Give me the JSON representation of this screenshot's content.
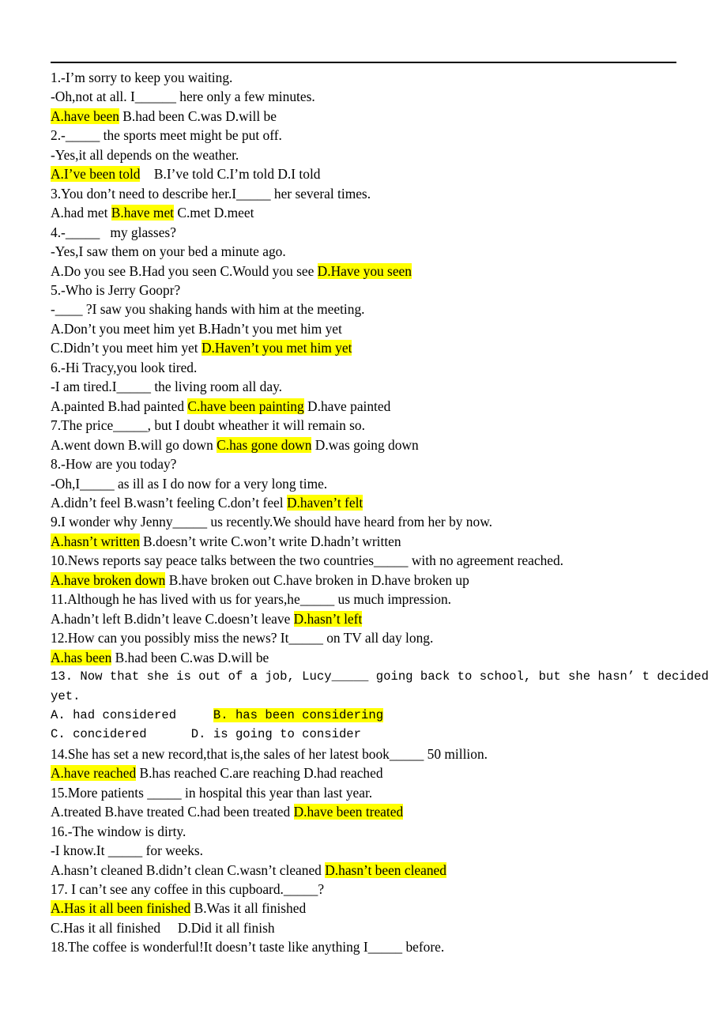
{
  "document": {
    "type": "english-grammar-worksheet",
    "topic": "Present perfect tense multiple-choice exercises",
    "highlight_color": "#ffff00",
    "text_color": "#000000",
    "page_background": "#ffffff",
    "top_rule": true
  },
  "lines": [
    {
      "id": "l1",
      "font": "serif",
      "text": "1.-I’m sorry to keep you waiting."
    },
    {
      "id": "l2",
      "font": "serif",
      "text": "-Oh,not at all. I______ here only a few minutes."
    },
    {
      "id": "l3",
      "font": "serif",
      "pre": "",
      "hl": "A.have been",
      "post": " B.had been C.was D.will be"
    },
    {
      "id": "l4",
      "font": "serif",
      "text": "2.-_____ the sports meet might be put off."
    },
    {
      "id": "l5",
      "font": "serif",
      "text": "-Yes,it all depends on the weather."
    },
    {
      "id": "l6",
      "font": "serif",
      "pre": "",
      "hl": "A.I’ve been told",
      "post": "    B.I’ve told C.I’m told D.I told"
    },
    {
      "id": "l7",
      "font": "serif",
      "text": "3.You don’t need to describe her.I_____ her several times."
    },
    {
      "id": "l8",
      "font": "serif",
      "pre": "A.had met ",
      "hl": "B.have met",
      "post": " C.met D.meet"
    },
    {
      "id": "l9",
      "font": "serif",
      "text": "4.-_____   my glasses?"
    },
    {
      "id": "l10",
      "font": "serif",
      "text": "-Yes,I saw them on your bed a minute ago."
    },
    {
      "id": "l11",
      "font": "serif",
      "pre": "A.Do you see B.Had you seen C.Would you see ",
      "hl": "D.Have you seen",
      "post": ""
    },
    {
      "id": "l12",
      "font": "serif",
      "text": "5.-Who is Jerry Goopr?"
    },
    {
      "id": "l13",
      "font": "serif",
      "text": "-____ ?I saw you shaking hands with him at the meeting."
    },
    {
      "id": "l14",
      "font": "serif",
      "text": "A.Don’t you meet him yet B.Hadn’t you met him yet"
    },
    {
      "id": "l15",
      "font": "serif",
      "pre": "C.Didn’t you meet him yet ",
      "hl": "D.Haven’t you met him yet",
      "post": ""
    },
    {
      "id": "l16",
      "font": "serif",
      "text": "6.-Hi Tracy,you look tired."
    },
    {
      "id": "l17",
      "font": "serif",
      "text": "-I am tired.I_____ the living room all day."
    },
    {
      "id": "l18",
      "font": "serif",
      "pre": "A.painted B.had painted ",
      "hl": "C.have been painting",
      "post": " D.have painted"
    },
    {
      "id": "l19",
      "font": "serif",
      "text": "7.The price_____, but I doubt wheather it will remain so."
    },
    {
      "id": "l20",
      "font": "serif",
      "pre": "A.went down B.will go down ",
      "hl": "C.has gone down",
      "post": " D.was going down"
    },
    {
      "id": "l21",
      "font": "serif",
      "text": "8.-How are you today?"
    },
    {
      "id": "l22",
      "font": "serif",
      "text": "-Oh,I_____ as ill as I do now for a very long time."
    },
    {
      "id": "l23",
      "font": "serif",
      "pre": "A.didn’t feel B.wasn’t feeling C.don’t feel ",
      "hl": "D.haven’t felt",
      "post": ""
    },
    {
      "id": "l24",
      "font": "serif",
      "text": "9.I wonder why Jenny_____ us recently.We should have heard from her by now."
    },
    {
      "id": "l25",
      "font": "serif",
      "pre": "",
      "hl": "A.hasn’t written",
      "post": " B.doesn’t write C.won’t write D.hadn’t written"
    },
    {
      "id": "l26",
      "font": "serif",
      "text": "10.News reports say peace talks between the two countries_____ with no agreement reached."
    },
    {
      "id": "l27",
      "font": "serif",
      "pre": "",
      "hl": "A.have broken down",
      "post": " B.have broken out C.have broken in D.have broken up"
    },
    {
      "id": "l28",
      "font": "serif",
      "text": "11.Although he has lived with us for years,he_____ us much impression."
    },
    {
      "id": "l29",
      "font": "serif",
      "pre": "A.hadn’t left B.didn’t leave C.doesn’t leave ",
      "hl": "D.hasn’t left",
      "post": ""
    },
    {
      "id": "l30",
      "font": "serif",
      "text": "12.How can you possibly miss the news? It_____ on TV all day long."
    },
    {
      "id": "l31",
      "font": "serif",
      "pre": "",
      "hl": "A.has been",
      "post": " B.had been C.was D.will be"
    },
    {
      "id": "l32",
      "font": "mono",
      "text": "13. Now that she is out of a job, Lucy_____ going back to school, but she hasn’ t decided"
    },
    {
      "id": "l33",
      "font": "mono",
      "text": "yet."
    },
    {
      "id": "l34",
      "font": "mono",
      "pre": "A. had considered     ",
      "hl": "B. has been considering",
      "post": ""
    },
    {
      "id": "l35",
      "font": "mono",
      "text": "C. concidered      D. is going to consider"
    },
    {
      "id": "l36",
      "font": "serif",
      "text": "14.She has set a new record,that is,the sales of her latest book_____ 50 million."
    },
    {
      "id": "l37",
      "font": "serif",
      "pre": "",
      "hl": "A.have reached",
      "post": " B.has reached C.are reaching D.had reached"
    },
    {
      "id": "l38",
      "font": "serif",
      "text": "15.More patients _____ in hospital this year than last year."
    },
    {
      "id": "l39",
      "font": "serif",
      "pre": "A.treated B.have treated C.had been treated ",
      "hl": "D.have been treated",
      "post": ""
    },
    {
      "id": "l40",
      "font": "serif",
      "text": "16.-The window is dirty."
    },
    {
      "id": "l41",
      "font": "serif",
      "text": "-I know.It _____ for weeks."
    },
    {
      "id": "l42",
      "font": "serif",
      "pre": "A.hasn’t cleaned B.didn’t clean C.wasn’t cleaned ",
      "hl": "D.hasn’t been cleaned",
      "post": ""
    },
    {
      "id": "l43",
      "font": "serif",
      "text": "17. I can’t see any coffee in this cupboard._____?"
    },
    {
      "id": "l44",
      "font": "serif",
      "pre": "",
      "hl": "A.Has it all been finished",
      "post": " B.Was it all finished"
    },
    {
      "id": "l45",
      "font": "serif",
      "text": "C.Has it all finished     D.Did it all finish"
    },
    {
      "id": "l46",
      "font": "serif",
      "text": "18.The coffee is wonderful!It doesn’t taste like anything I_____ before."
    }
  ],
  "questions": [
    {
      "number": "1",
      "prompt": [
        "1.-I’m sorry to keep you waiting.",
        "-Oh,not at all. I______ here only a few minutes."
      ],
      "options": [
        "A.have been",
        "B.had been",
        "C.was",
        "D.will be"
      ],
      "answer": "A"
    },
    {
      "number": "2",
      "prompt": [
        "2.-_____ the sports meet might be put off.",
        "-Yes,it all depends on the weather."
      ],
      "options": [
        "A.I’ve been told",
        "B.I’ve told",
        "C.I’m told",
        "D.I told"
      ],
      "answer": "A"
    },
    {
      "number": "3",
      "prompt": [
        "3.You don’t need to describe her.I_____ her several times."
      ],
      "options": [
        "A.had met",
        "B.have met",
        "C.met",
        "D.meet"
      ],
      "answer": "B"
    },
    {
      "number": "4",
      "prompt": [
        "4.-_____   my glasses?",
        "-Yes,I saw them on your bed a minute ago."
      ],
      "options": [
        "A.Do you see",
        "B.Had you seen",
        "C.Would you see",
        "D.Have you seen"
      ],
      "answer": "D"
    },
    {
      "number": "5",
      "prompt": [
        "5.-Who is Jerry Goopr?",
        "-____ ?I saw you shaking hands with him at the meeting."
      ],
      "options": [
        "A.Don’t you meet him yet",
        "B.Hadn’t you met him yet",
        "C.Didn’t you meet him yet",
        "D.Haven’t you met him yet"
      ],
      "answer": "D"
    },
    {
      "number": "6",
      "prompt": [
        "6.-Hi Tracy,you look tired.",
        "-I am tired.I_____ the living room all day."
      ],
      "options": [
        "A.painted",
        "B.had painted",
        "C.have been painting",
        "D.have painted"
      ],
      "answer": "C"
    },
    {
      "number": "7",
      "prompt": [
        "7.The price_____, but I doubt wheather it will remain so."
      ],
      "options": [
        "A.went down",
        "B.will go down",
        "C.has gone down",
        "D.was going down"
      ],
      "answer": "C"
    },
    {
      "number": "8",
      "prompt": [
        "8.-How are you today?",
        "-Oh,I_____ as ill as I do now for a very long time."
      ],
      "options": [
        "A.didn’t feel",
        "B.wasn’t feeling",
        "C.don’t feel",
        "D.haven’t felt"
      ],
      "answer": "D"
    },
    {
      "number": "9",
      "prompt": [
        "9.I wonder why Jenny_____ us recently.We should have heard from her by now."
      ],
      "options": [
        "A.hasn’t written",
        "B.doesn’t write",
        "C.won’t write",
        "D.hadn’t written"
      ],
      "answer": "A"
    },
    {
      "number": "10",
      "prompt": [
        "10.News reports say peace talks between the two countries_____ with no agreement reached."
      ],
      "options": [
        "A.have broken down",
        "B.have broken out",
        "C.have broken in",
        "D.have broken up"
      ],
      "answer": "A"
    },
    {
      "number": "11",
      "prompt": [
        "11.Although he has lived with us for years,he_____ us much impression."
      ],
      "options": [
        "A.hadn’t left",
        "B.didn’t leave",
        "C.doesn’t leave",
        "D.hasn’t left"
      ],
      "answer": "D"
    },
    {
      "number": "12",
      "prompt": [
        "12.How can you possibly miss the news? It_____ on TV all day long."
      ],
      "options": [
        "A.has been",
        "B.had been",
        "C.was",
        "D.will be"
      ],
      "answer": "A"
    },
    {
      "number": "13",
      "prompt": [
        "13. Now that she is out of a job, Lucy_____ going back to school, but she hasn’ t decided yet."
      ],
      "options": [
        "A. had considered",
        "B. has been considering",
        "C. concidered",
        "D. is going to consider"
      ],
      "answer": "B"
    },
    {
      "number": "14",
      "prompt": [
        "14.She has set a new record,that is,the sales of her latest book_____ 50 million."
      ],
      "options": [
        "A.have reached",
        "B.has reached",
        "C.are reaching",
        "D.had reached"
      ],
      "answer": "A"
    },
    {
      "number": "15",
      "prompt": [
        "15.More patients _____ in hospital this year than last year."
      ],
      "options": [
        "A.treated",
        "B.have treated",
        "C.had been treated",
        "D.have been treated"
      ],
      "answer": "D"
    },
    {
      "number": "16",
      "prompt": [
        "16.-The window is dirty.",
        "-I know.It _____ for weeks."
      ],
      "options": [
        "A.hasn’t cleaned",
        "B.didn’t clean",
        "C.wasn’t cleaned",
        "D.hasn’t been cleaned"
      ],
      "answer": "D"
    },
    {
      "number": "17",
      "prompt": [
        "17. I can’t see any coffee in this cupboard._____?"
      ],
      "options": [
        "A.Has it all been finished",
        "B.Was it all finished",
        "C.Has it all finished",
        "D.Did it all finish"
      ],
      "answer": "A"
    },
    {
      "number": "18",
      "prompt": [
        "18.The coffee is wonderful!It doesn’t taste like anything I_____ before."
      ],
      "options": [],
      "answer": ""
    }
  ]
}
